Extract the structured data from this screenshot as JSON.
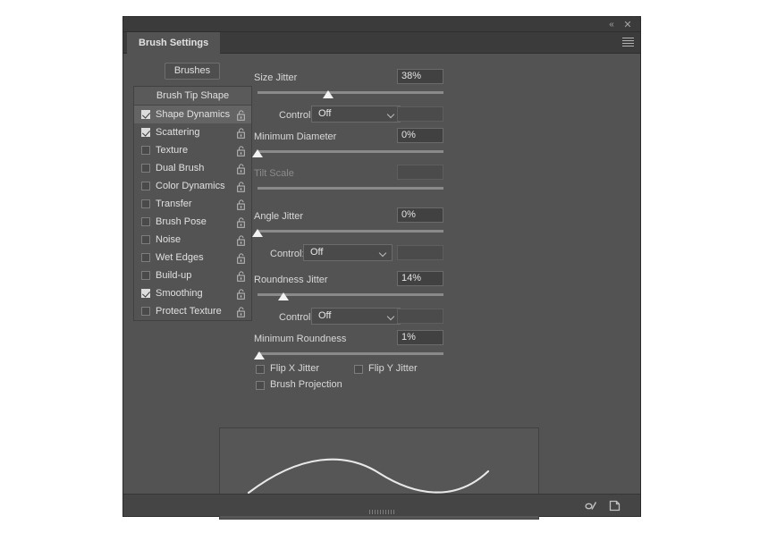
{
  "window": {
    "collapse_icon": "collapse-double-chevron-icon",
    "collapse_glyph": "«",
    "close_icon": "close-icon",
    "close_glyph": "✕",
    "menu_icon": "panel-menu-icon"
  },
  "tabs": [
    {
      "label": "Brush Settings",
      "active": true
    }
  ],
  "brushes_button": {
    "label": "Brushes"
  },
  "option_list": {
    "header": "Brush Tip Shape",
    "items": [
      {
        "label": "Shape Dynamics",
        "checked": true,
        "selected": true,
        "lock": "unlocked-padlock-icon"
      },
      {
        "label": "Scattering",
        "checked": true,
        "selected": false,
        "lock": "unlocked-padlock-icon"
      },
      {
        "label": "Texture",
        "checked": false,
        "selected": false,
        "lock": "unlocked-padlock-icon"
      },
      {
        "label": "Dual Brush",
        "checked": false,
        "selected": false,
        "lock": "unlocked-padlock-icon"
      },
      {
        "label": "Color Dynamics",
        "checked": false,
        "selected": false,
        "lock": "unlocked-padlock-icon"
      },
      {
        "label": "Transfer",
        "checked": false,
        "selected": false,
        "lock": "unlocked-padlock-icon"
      },
      {
        "label": "Brush Pose",
        "checked": false,
        "selected": false,
        "lock": "unlocked-padlock-icon"
      },
      {
        "label": "Noise",
        "checked": false,
        "selected": false,
        "lock": "unlocked-padlock-icon"
      },
      {
        "label": "Wet Edges",
        "checked": false,
        "selected": false,
        "lock": "unlocked-padlock-icon"
      },
      {
        "label": "Build-up",
        "checked": false,
        "selected": false,
        "lock": "unlocked-padlock-icon"
      },
      {
        "label": "Smoothing",
        "checked": true,
        "selected": false,
        "lock": "unlocked-padlock-icon"
      },
      {
        "label": "Protect Texture",
        "checked": false,
        "selected": false,
        "lock": "unlocked-padlock-icon"
      }
    ]
  },
  "shape_dynamics": {
    "size_jitter": {
      "label": "Size Jitter",
      "value": "38%",
      "percent": 38
    },
    "size_control": {
      "label": "Control:",
      "value": "Off",
      "extra_value": ""
    },
    "minimum_diameter": {
      "label": "Minimum Diameter",
      "value": "0%",
      "percent": 0
    },
    "tilt_scale": {
      "label": "Tilt Scale",
      "value": "",
      "percent": 0,
      "disabled": true
    },
    "angle_jitter": {
      "label": "Angle Jitter",
      "value": "0%",
      "percent": 0
    },
    "angle_control": {
      "label": "Control:",
      "value": "Off",
      "extra_value": ""
    },
    "roundness_jitter": {
      "label": "Roundness Jitter",
      "value": "14%",
      "percent": 14
    },
    "roundness_control": {
      "label": "Control:",
      "value": "Off",
      "extra_value": ""
    },
    "minimum_roundness": {
      "label": "Minimum Roundness",
      "value": "1%",
      "percent": 1
    },
    "flip_x_jitter": {
      "label": "Flip X Jitter",
      "checked": false
    },
    "flip_y_jitter": {
      "label": "Flip Y Jitter",
      "checked": false
    },
    "brush_projection": {
      "label": "Brush Projection",
      "checked": false
    }
  },
  "preview": {
    "name": "brush-stroke-preview",
    "stroke_color": "#e8e8e8"
  },
  "footer": {
    "toggle_icon": "toggle-brush-panel-icon",
    "new_icon": "new-brush-preset-icon",
    "resize_grip": "resize-grip"
  },
  "colors": {
    "panel_bg": "#535353",
    "chrome_bg": "#3b3b3b",
    "footer_bg": "#454545",
    "text": "#d8d8d8",
    "slider_track": "#8a8a8a",
    "thumb": "#f2f2f2"
  }
}
